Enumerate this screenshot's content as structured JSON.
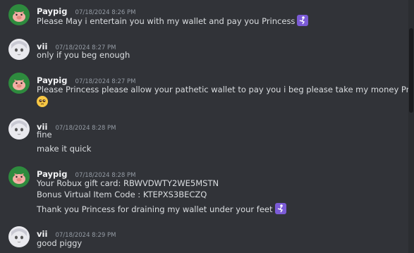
{
  "messages": [
    {
      "author": "Paypig",
      "timestamp": "07/18/2024 8:26 PM",
      "lines": [
        "Please May i entertain you with my wallet and pay you Princess"
      ]
    },
    {
      "author": "vii",
      "timestamp": "07/18/2024 8:27 PM",
      "lines": [
        "only if you beg enough"
      ]
    },
    {
      "author": "Paypig",
      "timestamp": "07/18/2024 8:27 PM",
      "lines": [
        "Please Princess please allow your pathetic wallet to pay you i beg please take my money Princess"
      ]
    },
    {
      "author": "vii",
      "timestamp": "07/18/2024 8:28 PM",
      "lines": [
        "fine",
        "make it quick"
      ]
    },
    {
      "author": "Paypig",
      "timestamp": "07/18/2024 8:28 PM",
      "lines": [
        "Your Robux gift card: RBWVDWTY2WE5MSTN",
        "Bonus Virtual Item Code : KTEPXS3BECZQ",
        "Thank you Princess for draining my wallet under your feet"
      ]
    },
    {
      "author": "vii",
      "timestamp": "07/18/2024 8:29 PM",
      "lines": [
        "good piggy"
      ]
    }
  ],
  "icons": {
    "kneel_emoji": "kneeling-person-icon",
    "pleading_emoji": "pleading-face-icon"
  },
  "colors": {
    "background": "#313338",
    "username": "#f2f3f5",
    "timestamp": "#949ba4",
    "text": "#dbdee1",
    "pig_avatar_bg": "#2e8b3e",
    "vii_avatar_bg": "#e9e9ee",
    "kneel_emoji_bg": "#7b5bd6"
  }
}
